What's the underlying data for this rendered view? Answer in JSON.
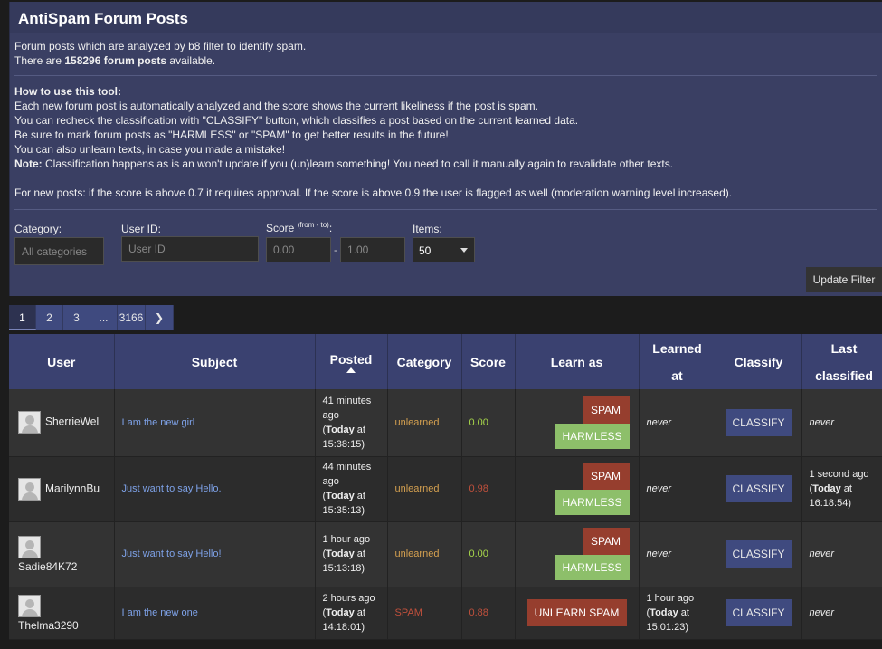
{
  "panel": {
    "title": "AntiSpam Forum Posts",
    "desc1": "Forum posts which are analyzed by b8 filter to identify spam.",
    "count_prefix": "There are ",
    "count_value": "158296 forum posts",
    "count_suffix": " available.",
    "howto_title": "How to use this tool:",
    "howto_lines": [
      "Each new forum post is automatically analyzed and the score shows the current likeliness if the post is spam.",
      "You can recheck the classification with \"CLASSIFY\" button, which classifies a post based on the current learned data.",
      "Be sure to mark forum posts as \"HARMLESS\" or \"SPAM\" to get better results in the future!",
      "You can also unlearn texts, in case you made a mistake!"
    ],
    "note_label": "Note:",
    "note_text": " Classification happens as is an won't update if you (un)learn something! You need to call it manually again to revalidate other texts.",
    "threshold_text": "For new posts: if the score is above 0.7 it requires approval. If the score is above 0.9 the user is flagged as well (moderation warning level increased)."
  },
  "filters": {
    "category_label": "Category:",
    "category_placeholder": "All categories",
    "userid_label": "User ID:",
    "userid_placeholder": "User ID",
    "score_label": "Score",
    "score_sup": "(from - to)",
    "score_colon": ":",
    "score_from_placeholder": "0.00",
    "score_dash": "-",
    "score_to_placeholder": "1.00",
    "items_label": "Items:",
    "items_value": "50",
    "update_button": "Update Filter"
  },
  "pagination": [
    "1",
    "2",
    "3",
    "...",
    "3166",
    "❯"
  ],
  "table": {
    "headers": {
      "user": "User",
      "subject": "Subject",
      "posted": "Posted",
      "category": "Category",
      "score": "Score",
      "learn_as": "Learn as",
      "learned_at_1": "Learned",
      "learned_at_2": "at",
      "classify": "Classify",
      "last_classified_1": "Last",
      "last_classified_2": "classified"
    },
    "rows": [
      {
        "user": "SherrieWel",
        "subject": "I am the new girl",
        "posted_ago": "41 minutes ago",
        "posted_today": "Today",
        "posted_time": " at 15:38:15)",
        "category": "unlearned",
        "score": "0.00",
        "spam_btn": "SPAM",
        "harmless_btn": "HARMLESS",
        "learned_at": "never",
        "classify_btn": "CLASSIFY",
        "last_classified": "never"
      },
      {
        "user": "MarilynnBu",
        "subject": "Just want to say Hello.",
        "posted_ago": "44 minutes ago",
        "posted_today": "Today",
        "posted_time": " at 15:35:13)",
        "category": "unlearned",
        "score": "0.98",
        "spam_btn": "SPAM",
        "harmless_btn": "HARMLESS",
        "learned_at": "never",
        "classify_btn": "CLASSIFY",
        "last_classified_ago": "1 second ago",
        "last_classified_today": "Today",
        "last_classified_time": " at 16:18:54)"
      },
      {
        "user": "Sadie84K72",
        "subject": "Just want to say Hello!",
        "posted_ago": "1 hour ago",
        "posted_today": "Today",
        "posted_time": " at 15:13:18)",
        "category": "unlearned",
        "score": "0.00",
        "spam_btn": "SPAM",
        "harmless_btn": "HARMLESS",
        "learned_at": "never",
        "classify_btn": "CLASSIFY",
        "last_classified": "never"
      },
      {
        "user": "Thelma3290",
        "subject": "I am the new one",
        "posted_ago": "2 hours ago",
        "posted_today": "Today",
        "posted_time": " at 14:18:01)",
        "category": "SPAM",
        "score": "0.88",
        "unlearn_btn": "UNLEARN SPAM",
        "learned_ago": "1 hour ago",
        "learned_today": "Today",
        "learned_time": " at 15:01:23)",
        "classify_btn": "CLASSIFY",
        "last_classified": "never"
      }
    ]
  },
  "colors": {
    "panel_bg": "#3a3f63",
    "header_bg": "#3a4170",
    "spam_red": "#963e2e",
    "harmless_green": "#8dbf6a",
    "classify_blue": "#3f4a7f",
    "score_green": "#a8d84a",
    "unlearned_orange": "#d4a050"
  }
}
